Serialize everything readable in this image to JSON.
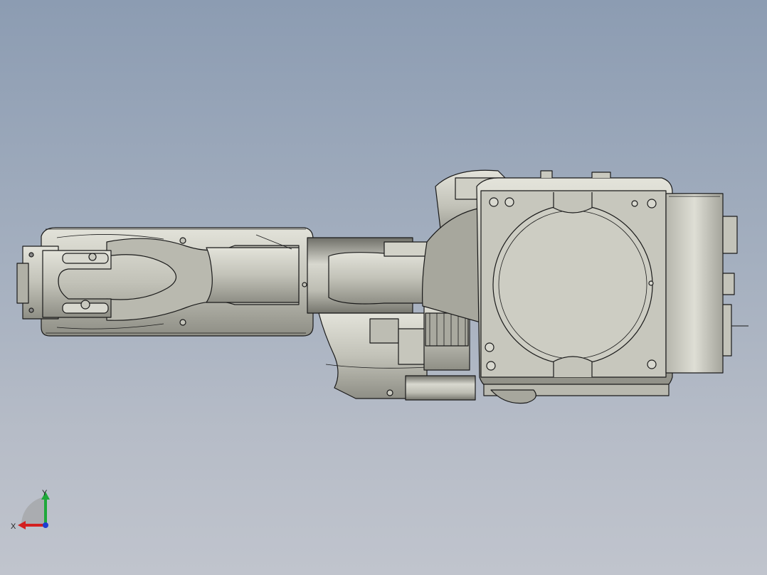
{
  "viewport": {
    "background_top": "#8c9cb2",
    "background_bottom": "#c0c4cd"
  },
  "model": {
    "icon": "robot-arm-model",
    "body_color": "#c9c9bf",
    "shade_color": "#8f8f86",
    "edge_color": "#1a1a1a"
  },
  "triad": {
    "x_label": "X",
    "y_label": "Y",
    "x_color": "#d32020",
    "y_color": "#1fa83a",
    "z_color": "#1d3fd0"
  }
}
